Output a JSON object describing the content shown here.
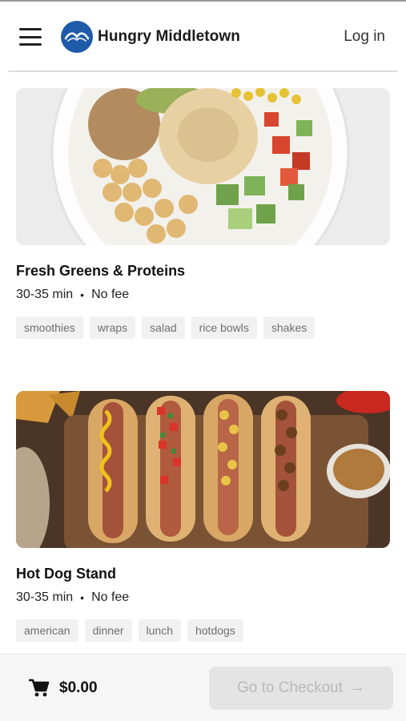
{
  "app": {
    "brand_name": "Hungry Middletown",
    "login_label": "Log in",
    "menu_icon": "hamburger-icon",
    "logo_icon": "wave-logo-icon",
    "brand_color": "#1f5bab"
  },
  "restaurants": [
    {
      "name": "Fresh Greens & Proteins",
      "time": "30-35 min",
      "separator": "•",
      "fee": "No fee",
      "tags": [
        "smoothies",
        "wraps",
        "salad",
        "rice bowls",
        "shakes"
      ],
      "image_icon": "salad-bowl-image"
    },
    {
      "name": "Hot Dog Stand",
      "time": "30-35 min",
      "separator": "•",
      "fee": "No fee",
      "tags": [
        "american",
        "dinner",
        "lunch",
        "hotdogs"
      ],
      "image_icon": "hotdogs-image"
    }
  ],
  "cart": {
    "icon": "cart-icon",
    "total": "$0.00",
    "checkout_label": "Go to Checkout",
    "checkout_arrow": "→"
  }
}
